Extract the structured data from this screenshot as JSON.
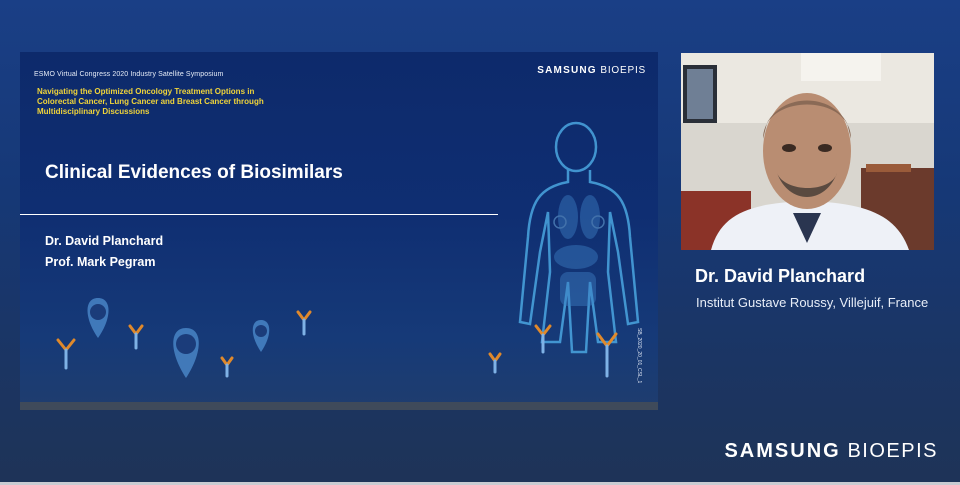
{
  "slide": {
    "conference": "ESMO Virtual Congress 2020 Industry Satellite Symposium",
    "subtitle": "Navigating the Optimized Oncology Treatment Options in Colorectal Cancer, Lung Cancer and Breast Cancer through Multidisciplinary Discussions",
    "brand_bold": "SAMSUNG",
    "brand_light": "BIOEPIS",
    "title": "Clinical Evidences of Biosimilars",
    "presenters": [
      "Dr. David Planchard",
      "Prof. Mark Pegram"
    ],
    "code": "SB_2020_20_01_CSL_1"
  },
  "speaker": {
    "name": "Dr. David Planchard",
    "affiliation": "Institut Gustave Roussy, Villejuif, France"
  },
  "footer": {
    "brand_bold": "SAMSUNG",
    "brand_light": "BIOEPIS"
  },
  "colors": {
    "background": "#1a3f86",
    "slide": "#0f2e72",
    "subtitle": "#f0d43a",
    "antibody_orange": "#e0892b",
    "antibody_blue": "#7fb2e6",
    "pin": "#4f8fd0"
  },
  "icons": [
    "map-pin-lungs-icon",
    "map-pin-colon-icon",
    "map-pin-breast-icon",
    "antibody-icon",
    "body-silhouette-icon"
  ]
}
